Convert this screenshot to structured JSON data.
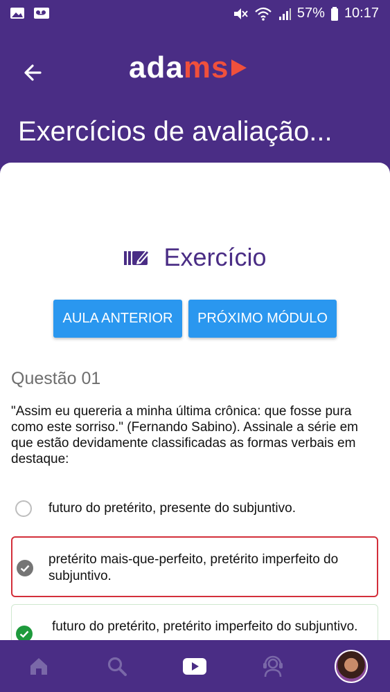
{
  "status_bar": {
    "battery": "57%",
    "time": "10:17"
  },
  "header": {
    "logo_prefix": "ada",
    "logo_accent": "ms",
    "title": "Exercícios de avaliação..."
  },
  "exercise": {
    "heading": "Exercício",
    "prev_button": "AULA ANTERIOR",
    "next_button": "PRÓXIMO MÓDULO"
  },
  "question": {
    "label": "Questão 01",
    "text": "\"Assim eu quereria a minha última crônica: que fosse pura como este sorriso.\" (Fernando Sabino). Assinale a série em que estão devidamente classificadas as formas verbais em destaque:",
    "options": [
      {
        "text": "futuro do pretérito, presente do subjuntivo.",
        "state": "unselected"
      },
      {
        "text": "pretérito mais-que-perfeito, pretérito imperfeito do subjuntivo.",
        "state": "selected-wrong"
      },
      {
        "text": " futuro do pretérito, pretérito imperfeito do subjuntivo.",
        "state": "correct"
      }
    ]
  },
  "colors": {
    "brand": "#4a2d85",
    "button": "#2a97ef",
    "wrong": "#d32f3a",
    "correct": "#1e9a3c",
    "logo_accent": "#f0503c"
  },
  "bottom_nav": {
    "items": [
      "home-icon",
      "search-icon",
      "play-icon",
      "support-headset-icon",
      "avatar"
    ]
  }
}
